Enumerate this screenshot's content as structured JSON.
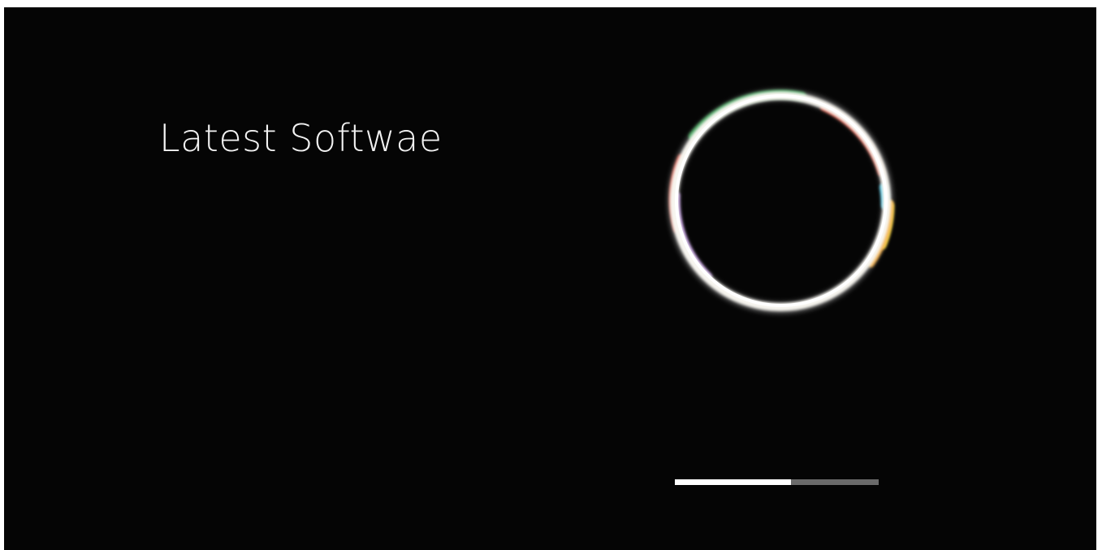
{
  "screen": {
    "headline": "Latest Softwae",
    "ring_icon": "loading-ring-icon",
    "progress": {
      "value": 0.57
    }
  },
  "colors": {
    "background": "#050505",
    "text": "#f2f2f2",
    "progress_track": "#6a6a6a",
    "progress_fill": "#ffffff",
    "ring_green": "#2e9a4a",
    "ring_red": "#d9422f",
    "ring_violet": "#b48ad6",
    "ring_cyan": "#47c6e6",
    "ring_yellow": "#f2d230",
    "ring_orange": "#f0a02a"
  }
}
